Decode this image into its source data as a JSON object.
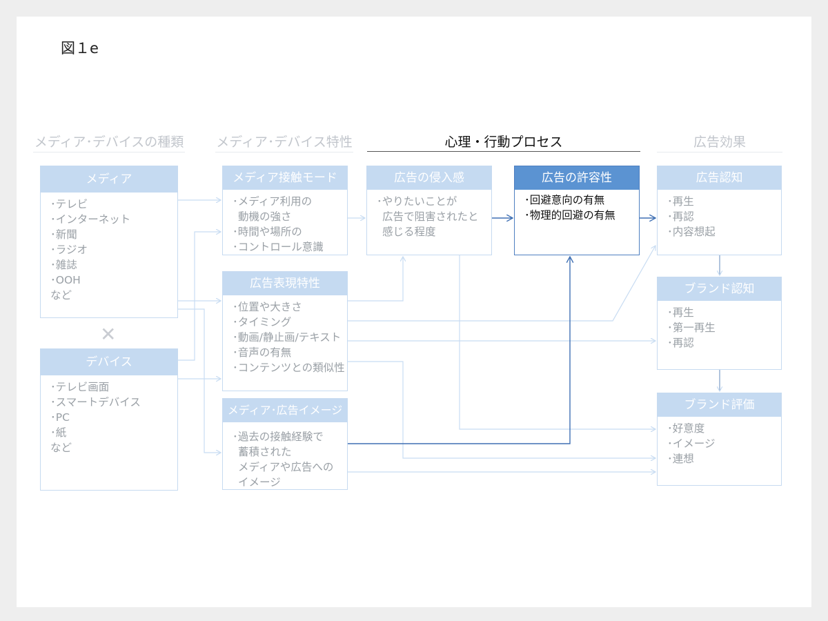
{
  "figure_label": "図１e",
  "columns": {
    "col1": "メディア･デバイスの種類",
    "col2": "メディア･デバイス特性",
    "col3": "心理・行動プロセス",
    "col4": "広告効果"
  },
  "boxes": {
    "media": {
      "title": "メディア",
      "items": [
        "･テレビ",
        "･インターネット",
        "･新聞",
        "･ラジオ",
        "･雑誌",
        "･OOH",
        "など"
      ]
    },
    "device": {
      "title": "デバイス",
      "items": [
        "･テレビ画面",
        "･スマートデバイス",
        "･PC",
        "･紙",
        "など"
      ]
    },
    "contact_mode": {
      "title": "メディア接触モード",
      "items": [
        "･メディア利用の",
        "動機の強さ",
        "･時間や場所の",
        "･コントロール意識"
      ]
    },
    "ad_expression": {
      "title": "広告表現特性",
      "items": [
        "･位置や大きさ",
        "･タイミング",
        "･動画/静止画/テキスト",
        "･音声の有無",
        "･コンテンツとの類似性"
      ]
    },
    "media_image": {
      "title": "メディア･広告イメージ",
      "items": [
        "･過去の接触経験で",
        "蓄積された",
        "メディアや広告への",
        "イメージ"
      ]
    },
    "intrusiveness": {
      "title": "広告の侵入感",
      "items": [
        "･やりたいことが",
        "広告で阻害されたと",
        "感じる程度"
      ]
    },
    "acceptance": {
      "title": "広告の許容性",
      "items": [
        "･回避意向の有無",
        "･物理的回避の有無"
      ]
    },
    "ad_recognition": {
      "title": "広告認知",
      "items": [
        "･再生",
        "･再認",
        "･内容想起"
      ]
    },
    "brand_recognition": {
      "title": "ブランド認知",
      "items": [
        "･再生",
        "･第一再生",
        "･再認"
      ]
    },
    "brand_evaluation": {
      "title": "ブランド評価",
      "items": [
        "･好意度",
        "･イメージ",
        "･連想"
      ]
    }
  },
  "colors": {
    "faded_header": "#c5daf1",
    "active_header": "#5b93d2",
    "active_border": "#4d7ec0",
    "faded_line": "#c8dcf2",
    "active_line": "#3e6fb3"
  }
}
